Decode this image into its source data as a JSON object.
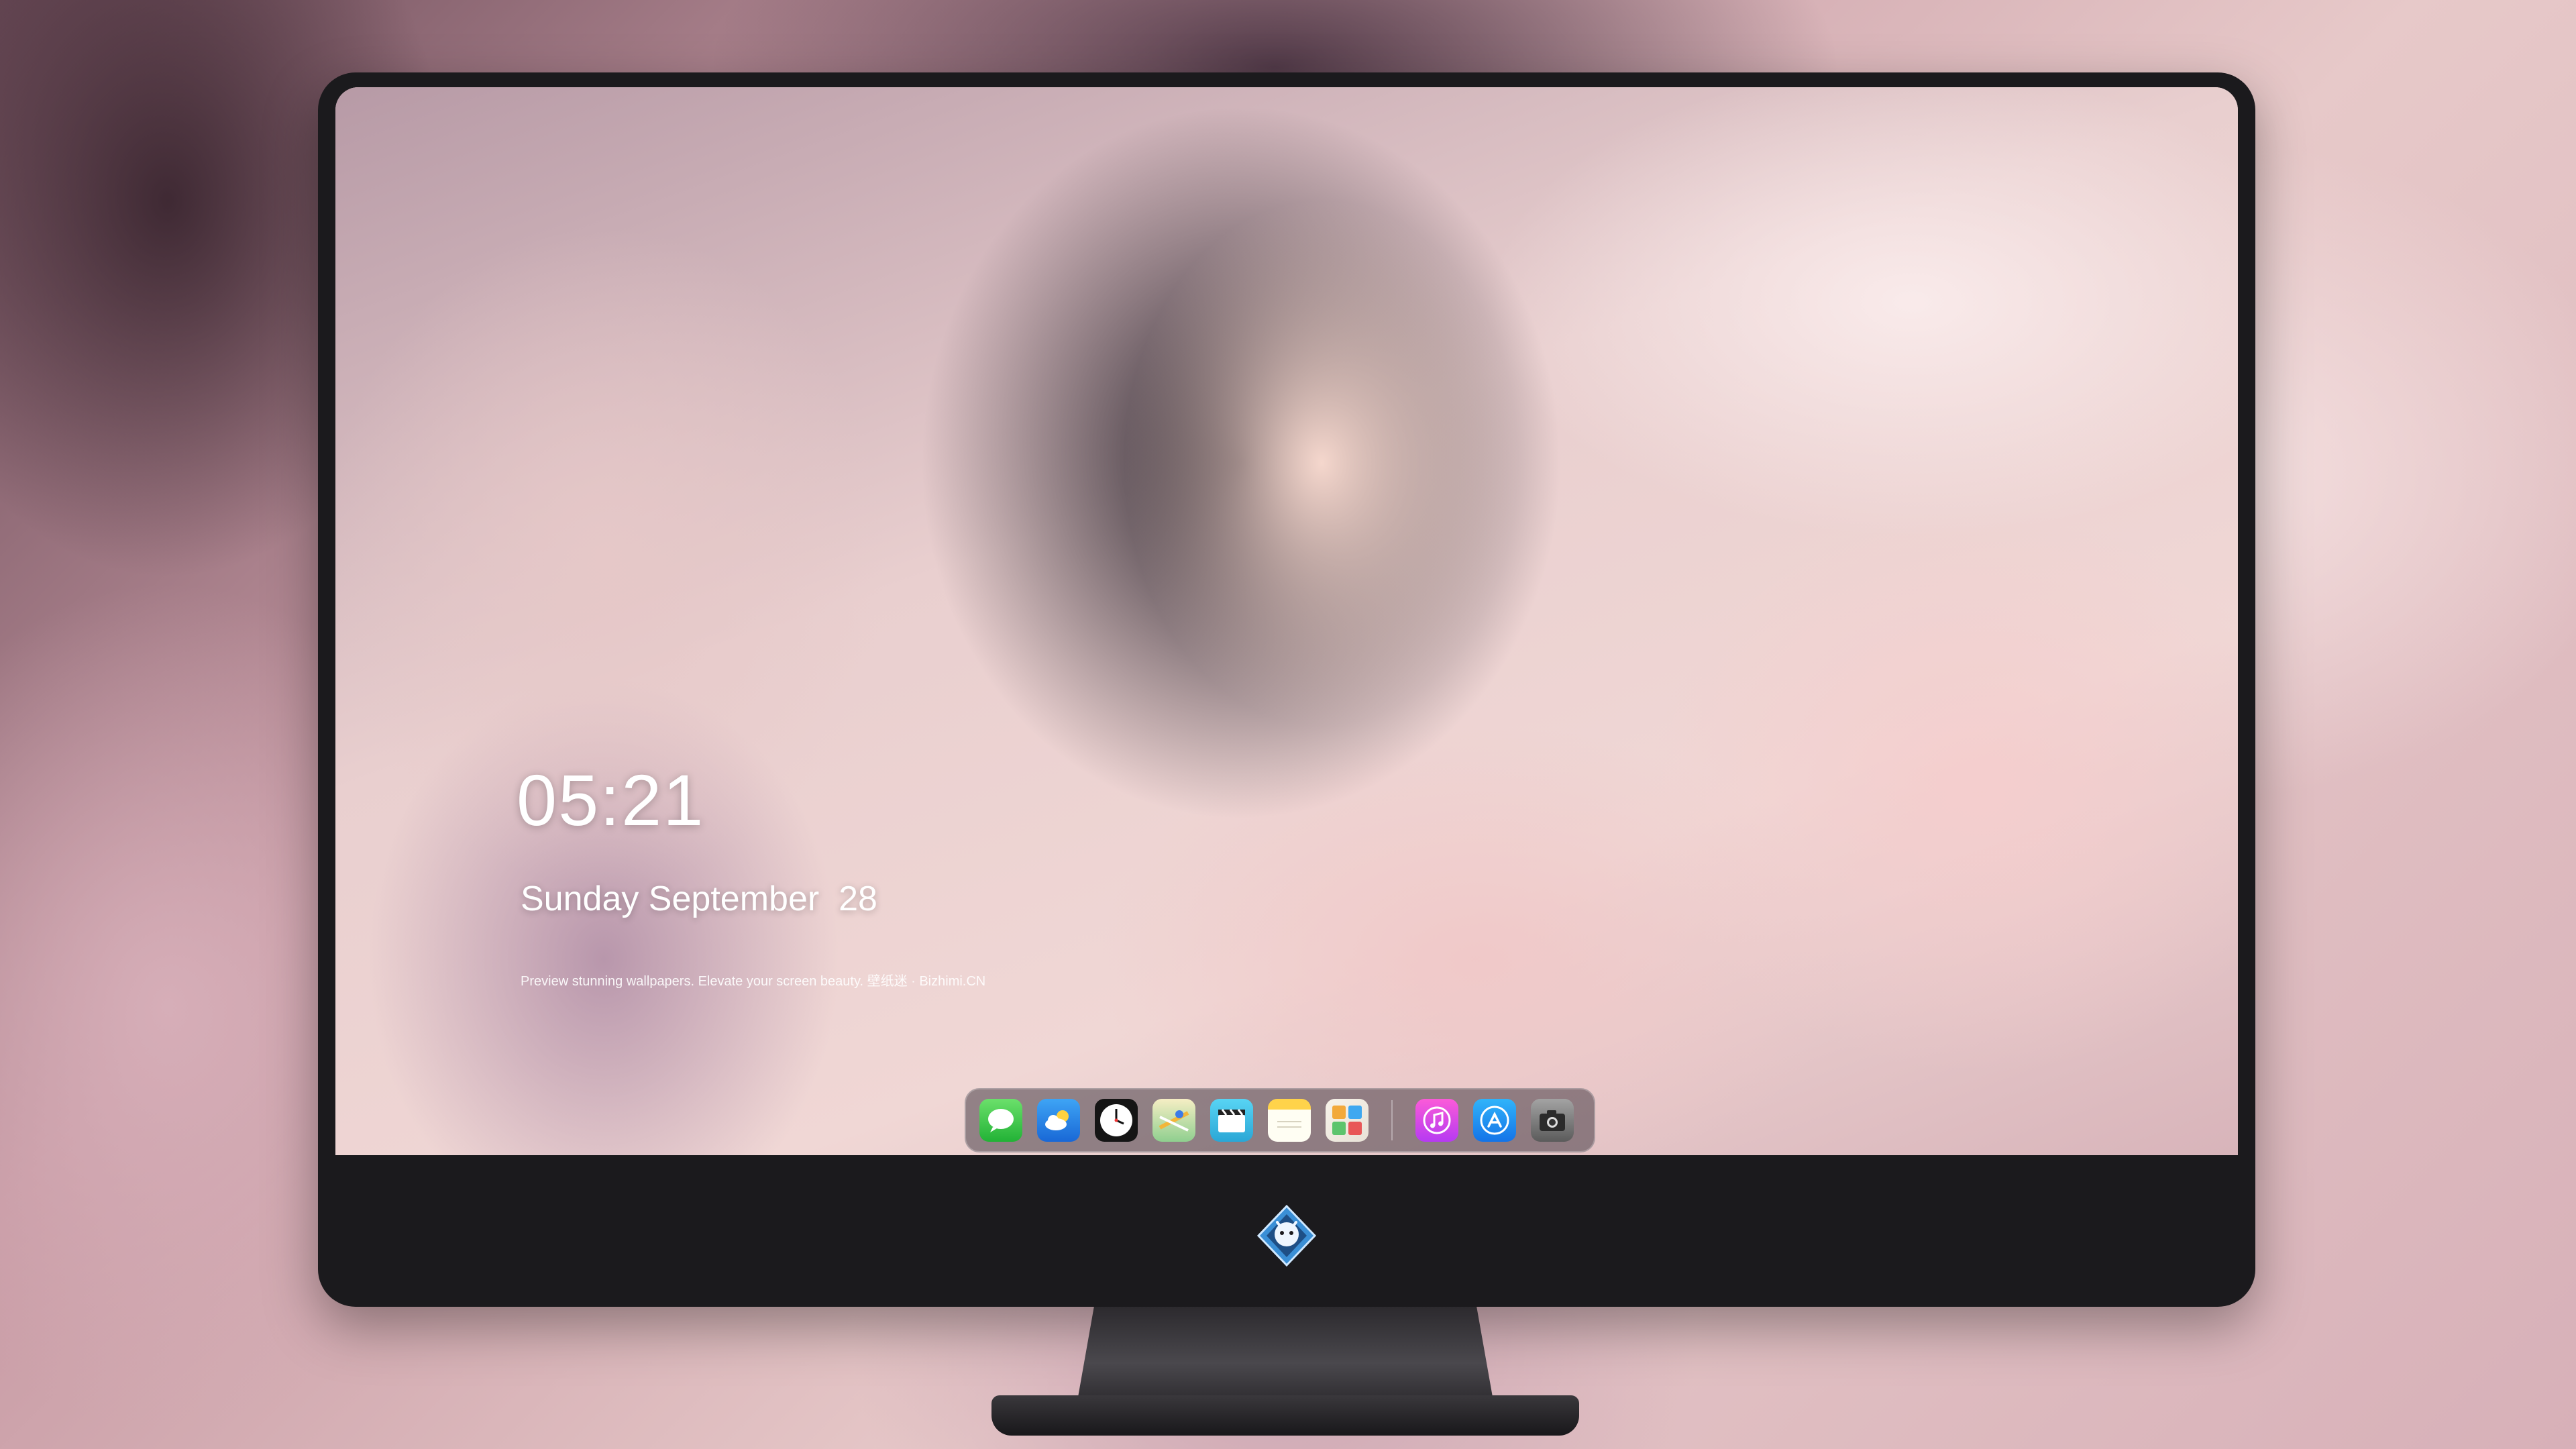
{
  "lock_screen": {
    "time": "05:21",
    "date": "Sunday September  28",
    "tagline": "Preview stunning wallpapers. Elevate your screen beauty. 壁纸迷 · Bizhimi.CN"
  },
  "dock": {
    "apps": [
      {
        "name": "Messages",
        "icon": "messages-icon"
      },
      {
        "name": "Weather",
        "icon": "weather-icon"
      },
      {
        "name": "Clock",
        "icon": "clock-icon"
      },
      {
        "name": "Maps",
        "icon": "maps-icon"
      },
      {
        "name": "Clips",
        "icon": "clips-icon"
      },
      {
        "name": "Notes",
        "icon": "notes-icon"
      },
      {
        "name": "Photos",
        "icon": "photos-icon"
      }
    ],
    "pinned": [
      {
        "name": "Music",
        "icon": "music-icon"
      },
      {
        "name": "App Store",
        "icon": "app-store-icon"
      },
      {
        "name": "Camera",
        "icon": "camera-icon"
      }
    ]
  },
  "monitor": {
    "logo": "dragon-mascot-logo"
  },
  "colors": {
    "bezel": "#1b1a1d",
    "text": "#ffffff"
  }
}
